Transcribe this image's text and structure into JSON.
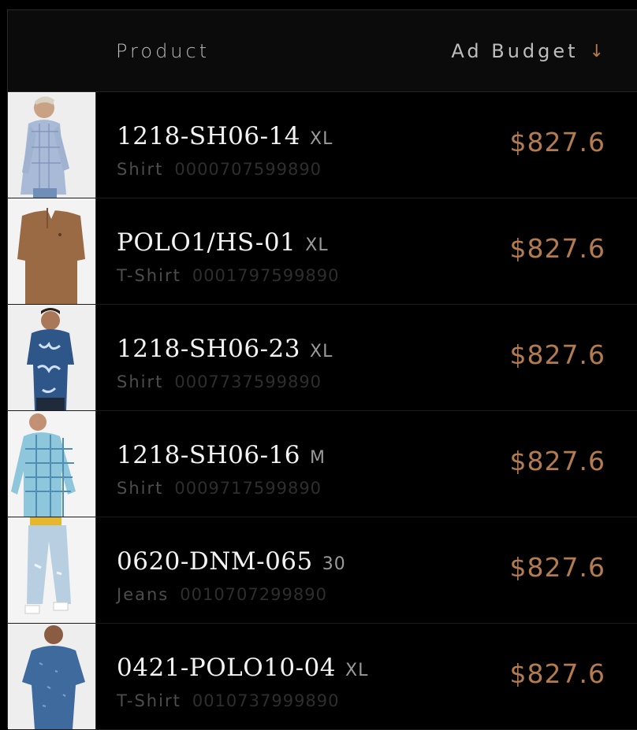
{
  "header": {
    "product_label": "Product",
    "budget_label": "Ad Budget",
    "sort_icon": "arrow-down-icon",
    "sort_glyph": "↓"
  },
  "colors": {
    "background": "#000000",
    "header_bg": "#0b0b0b",
    "accent_price": "#b47a50"
  },
  "rows": [
    {
      "sku": "1218-SH06-14",
      "size": "XL",
      "category": "Shirt",
      "code": "0000707599890",
      "budget": "$827.6",
      "image": "light-blue-checked-shirt"
    },
    {
      "sku": "POLO1/HS-01",
      "size": "XL",
      "category": "T-Shirt",
      "code": "0001797599890",
      "budget": "$827.6",
      "image": "brown-henley-tshirt"
    },
    {
      "sku": "1218-SH06-23",
      "size": "XL",
      "category": "Shirt",
      "code": "0007737599890",
      "budget": "$827.6",
      "image": "blue-printed-shirt"
    },
    {
      "sku": "1218-SH06-16",
      "size": "M",
      "category": "Shirt",
      "code": "0009717599890",
      "budget": "$827.6",
      "image": "teal-checked-shirt"
    },
    {
      "sku": "0620-DNM-065",
      "size": "30",
      "category": "Jeans",
      "code": "0010707299890",
      "budget": "$827.6",
      "image": "light-wash-jeans"
    },
    {
      "sku": "0421-POLO10-04",
      "size": "XL",
      "category": "T-Shirt",
      "code": "0010737999890",
      "budget": "$827.6",
      "image": "blue-melange-tshirt"
    }
  ]
}
